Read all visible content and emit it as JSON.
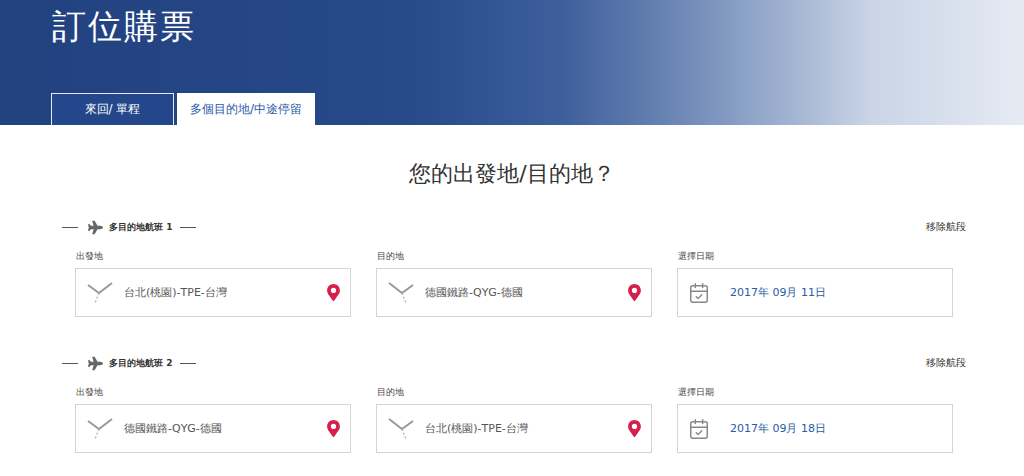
{
  "page": {
    "title": "訂位購票"
  },
  "tabs": [
    {
      "label": "來回/ 單程",
      "selected": false
    },
    {
      "label": "多個目的地/中途停留",
      "selected": true
    }
  ],
  "heading": "您的出發地/目的地？",
  "segments": [
    {
      "title": "多目的地航班 1",
      "remove": "移除航段",
      "fields": [
        {
          "kind": "departure",
          "label": "出發地",
          "value": "台北(桃園)-TPE-台灣"
        },
        {
          "kind": "arrival",
          "label": "目的地",
          "value": "德國鐵路-QYG-德國"
        },
        {
          "kind": "date",
          "label": "選擇日期",
          "value": "2017年 09月 11日"
        }
      ]
    },
    {
      "title": "多目的地航班 2",
      "remove": "移除航段",
      "fields": [
        {
          "kind": "departure",
          "label": "出發地",
          "value": "德國鐵路-QYG-德國"
        },
        {
          "kind": "arrival",
          "label": "目的地",
          "value": "台北(桃園)-TPE-台灣"
        },
        {
          "kind": "date",
          "label": "選擇日期",
          "value": "2017年 09月 18日"
        }
      ]
    }
  ]
}
